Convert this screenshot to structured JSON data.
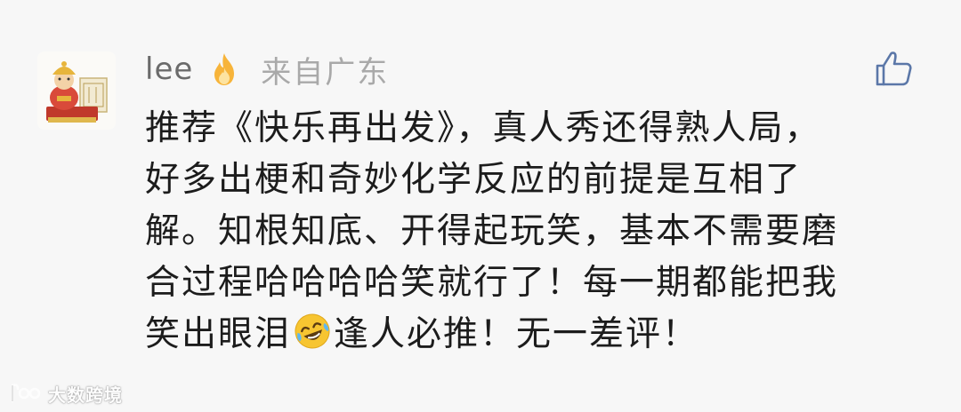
{
  "comment": {
    "username": "lee",
    "user_badge_icon": "fire-icon",
    "location": "来自广东",
    "like_icon": "thumbs-up-icon",
    "lines": [
      "推荐《快乐再出发》，真人秀还得熟人局，",
      "好多出梗和奇妙化学反应的前提是互相了",
      "解。知根知底、开得起玩笑，基本不需要磨",
      "合过程哈哈哈哈笑就行了！每一期都能把我"
    ],
    "last_line_before_emoji": "笑出眼泪",
    "emoji": "laughing-tears-emoji",
    "last_line_after_emoji": "逢人必推！无一差评！"
  },
  "watermark": {
    "text": "大数跨境"
  },
  "colors": {
    "background": "#f7f7f7",
    "text": "#1c1c1c",
    "username": "#6b6b6b",
    "location": "#a9a9a9",
    "like": "#5b77a8",
    "fire": "#f5a623"
  }
}
